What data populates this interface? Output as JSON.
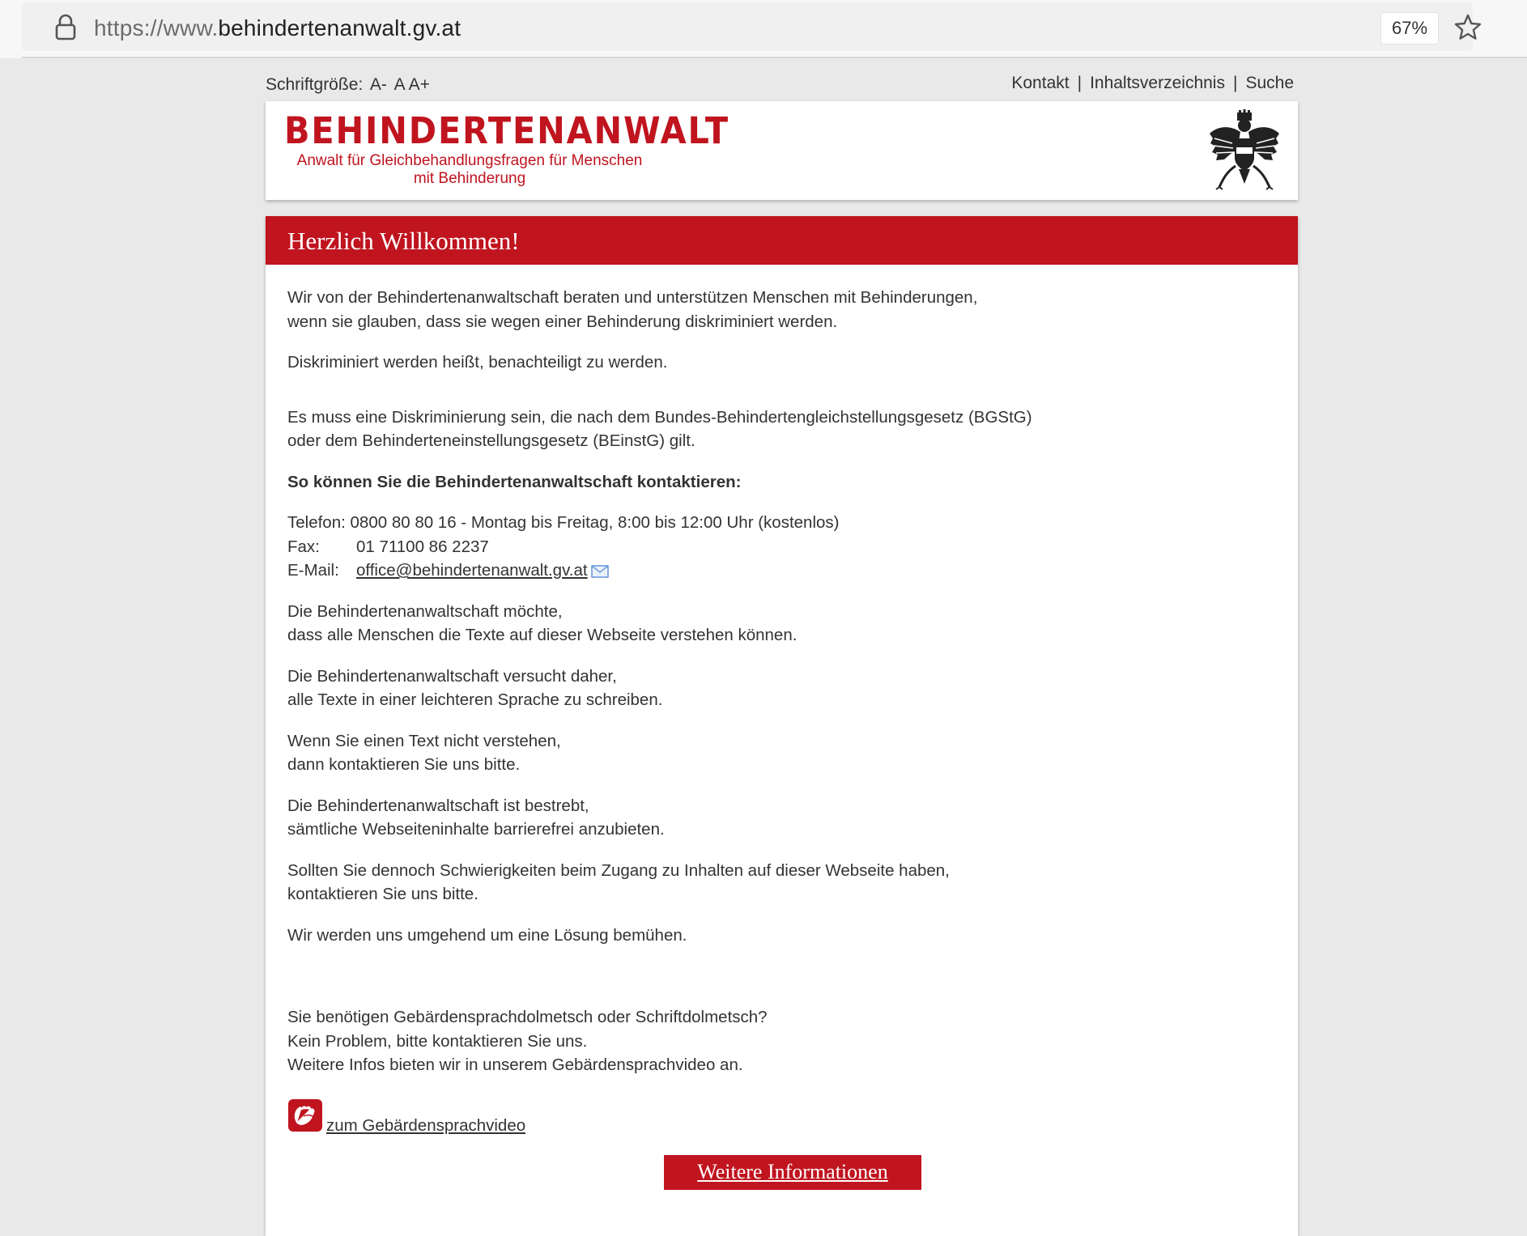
{
  "browser": {
    "url_prefix": "https://www.",
    "url_domain": "behindertenanwalt.gv.at",
    "zoom": "67%"
  },
  "utility": {
    "fontsize_label": "Schriftgröße:",
    "fontsize_smaller": "A-",
    "fontsize_normal": "A",
    "fontsize_larger": "A+",
    "links": [
      "Kontakt",
      "Inhaltsverzeichnis",
      "Suche"
    ],
    "separator": "|"
  },
  "header": {
    "logo_title": "BEHINDERTENANWALT",
    "logo_subtitle_line1": "Anwalt für Gleichbehandlungsfragen für Menschen",
    "logo_subtitle_line2": "mit Behinderung"
  },
  "main": {
    "banner_title": "Herzlich Willkommen!",
    "intro_line1": "Wir von der Behindertenanwaltschaft beraten und unterstützen Menschen mit Behinderungen,",
    "intro_line2": "wenn sie glauben, dass sie wegen einer Behinderung diskriminiert werden.",
    "discrimination": "Diskriminiert werden heißt, benachteiligt zu werden.",
    "law_line1": "Es muss eine Diskriminierung sein, die nach dem Bundes-Behindertengleichstellungsgesetz (BGStG)",
    "law_line2": "oder dem Behinderteneinstellungsgesetz (BEinstG) gilt.",
    "contact_heading": "So können Sie die Behindertenanwaltschaft kontaktieren:",
    "contact": {
      "phone_label": "Telefon:",
      "phone_value": "0800 80 80 16 - Montag bis Freitag, 8:00 bis 12:00 Uhr (kostenlos)",
      "fax_label": "Fax:",
      "fax_value": "01 71100 86 2237",
      "email_label": "E-Mail:",
      "email_value": "office@behindertenanwalt.gv.at"
    },
    "understand_line1": "Die Behindertenanwaltschaft möchte,",
    "understand_line2": "dass alle Menschen die Texte auf dieser Webseite verstehen können.",
    "easy_line1": "Die Behindertenanwaltschaft versucht daher,",
    "easy_line2": "alle Texte in einer leichteren Sprache zu schreiben.",
    "notunderstand_line1": "Wenn Sie einen Text nicht verstehen,",
    "notunderstand_line2": "dann kontaktieren Sie uns bitte.",
    "barrierfree_line1": "Die Behindertenanwaltschaft ist bestrebt,",
    "barrierfree_line2": "sämtliche Webseiteninhalte barrierefrei anzubieten.",
    "difficulty_line1": "Sollten Sie dennoch Schwierigkeiten beim Zugang zu Inhalten auf dieser Webseite haben,",
    "difficulty_line2": "kontaktieren Sie uns bitte.",
    "solution": "Wir werden uns umgehend um eine Lösung bemühen.",
    "sign_line1": "Sie benötigen Gebärdensprachdolmetsch oder Schriftdolmetsch?",
    "sign_line2": "Kein Problem, bitte kontaktieren Sie uns.",
    "sign_line3": "Weitere Infos bieten wir in unserem Gebärdensprachvideo an.",
    "video_link": " zum Gebärdensprachvideo",
    "more_button": "Weitere Informationen"
  },
  "colors": {
    "brand_red": "#c0141f",
    "text": "#333333"
  },
  "icons": [
    "lock-icon",
    "star-icon",
    "eagle-coat-of-arms-icon",
    "mail-icon",
    "sign-language-icon"
  ]
}
